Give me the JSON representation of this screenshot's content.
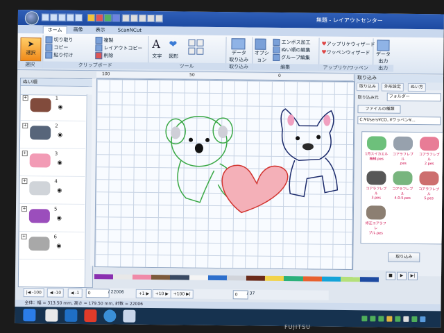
{
  "window": {
    "title": "無題 - レイアウトセンター"
  },
  "ribbon_tabs": [
    "ホーム",
    "画像",
    "表示",
    "ScanNCut"
  ],
  "ribbon": {
    "select": "選択",
    "select_group": "選択",
    "cut": "切り取り",
    "copy": "コピー",
    "paste": "貼り付け",
    "duplicate": "複製",
    "layout_copy": "レイアウトコピー",
    "delete": "削除",
    "clipboard_group": "クリップボード",
    "text": "文字",
    "shape": "図形",
    "tools_group": "ツール",
    "data_import": "データ\n取り込み",
    "import_group": "取り込み",
    "options": "オプション\n編集",
    "emboss": "エンボス加工",
    "sew_order": "ぬい順の編集",
    "group_edit": "グループ編集",
    "edit_group": "編集",
    "applique_wizard": "アップリケウィザード",
    "wappen_wizard": "ワッペンウィザード",
    "applique_group": "アップリケ/ワッペン",
    "data_out": "データ\n出力",
    "out_group": "出力"
  },
  "left_panel": {
    "title": "ぬい順",
    "rows": [
      {
        "num": "1",
        "color": "#6b2b1a"
      },
      {
        "num": "2",
        "color": "#3a4a63"
      },
      {
        "num": "3",
        "color": "#f08aa8"
      },
      {
        "num": "4",
        "color": "#c8ccd2"
      },
      {
        "num": "5",
        "color": "#8a2fb0"
      },
      {
        "num": "6",
        "color": "#999999"
      }
    ]
  },
  "ruler": {
    "labels": [
      "100",
      "50",
      "0"
    ]
  },
  "right_panel": {
    "title": "取り込み",
    "tabs": [
      "取り込み",
      "外形設定",
      "ぬい方"
    ],
    "source_label": "取り込み元",
    "source_value": "フォルダー",
    "file_type_button": "ファイルの種類",
    "path": "C:¥Users¥CO..¥ワッペン¥...",
    "thumbnails": [
      {
        "label": "1月スイカエル\n機械.pes",
        "color": "#49b05a"
      },
      {
        "label": "コアラフレブル\n.pes",
        "color": "#7d8a99"
      },
      {
        "label": "コアラフレブル\n2.pes",
        "color": "#e25b7c"
      },
      {
        "label": "コアラフレブル\n3.pes",
        "color": "#2d2d2d"
      },
      {
        "label": "コアラフレブル\n4.0-5.pes",
        "color": "#56a25e"
      },
      {
        "label": "コアラフレブル\n5.pes",
        "color": "#c04a4a"
      },
      {
        "label": "修正コアラフレ\nブル.pes",
        "color": "#6f5f4f"
      }
    ],
    "import_button": "取り込み"
  },
  "colorbar": {
    "colors": [
      "#8a2fb0",
      "#e8e8e8",
      "#f08aa8",
      "#7d5a3c",
      "#3a4a63",
      "#f4f4f4",
      "#2d6fcc",
      "#d1d4da",
      "#6b2b1a",
      "#f2d34a",
      "#2bb07a",
      "#e7612f",
      "#14a3d8",
      "#b4e07a",
      "#1d4aa1"
    ],
    "stop": "■",
    "play": "▶",
    "next": "▶|"
  },
  "stepbar": {
    "buttons": [
      "|◀ -100",
      "◀ -10",
      "◀ -1"
    ],
    "current": "0",
    "total": "/ 22006",
    "forward": [
      "+1 ▶",
      "+10 ▶",
      "+100 ▶|"
    ],
    "page": "0",
    "page_total": "/ 37"
  },
  "status": {
    "text": "全体：幅 = 313.50 mm, 高さ = 179.50 mm, 針数 = 22006"
  },
  "brand": "FUJITSU"
}
